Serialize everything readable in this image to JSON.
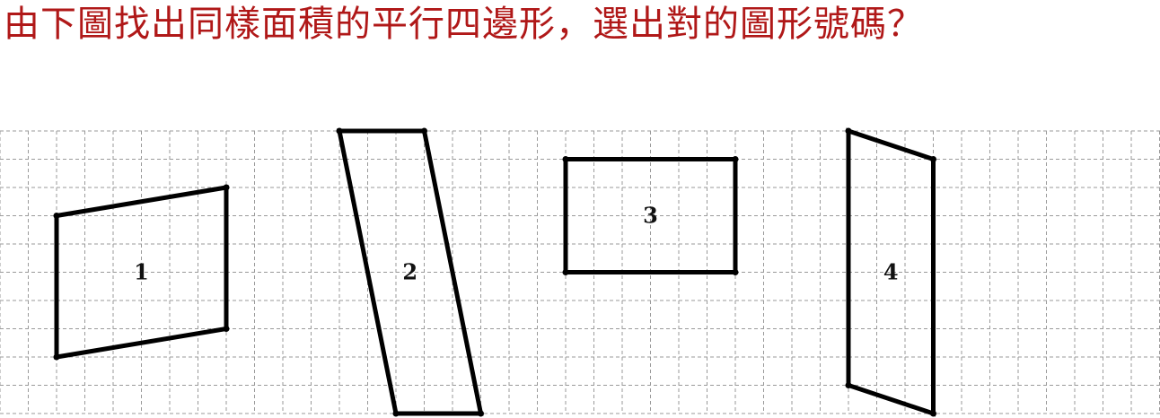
{
  "question": {
    "text": "由下圖找出同樣面積的平行四邊形，選出對的圖形號碼？",
    "color": "#b01818"
  },
  "grid": {
    "columns": 41,
    "rows": 10
  },
  "shapes": [
    {
      "label": "1",
      "vertices": [
        [
          2,
          3
        ],
        [
          8,
          2
        ],
        [
          8,
          7
        ],
        [
          2,
          8
        ]
      ]
    },
    {
      "label": "2",
      "vertices": [
        [
          12,
          0
        ],
        [
          15,
          0
        ],
        [
          17,
          10
        ],
        [
          14,
          10
        ]
      ]
    },
    {
      "label": "3",
      "vertices": [
        [
          20,
          1
        ],
        [
          26,
          1
        ],
        [
          26,
          5
        ],
        [
          20,
          5
        ]
      ]
    },
    {
      "label": "4",
      "vertices": [
        [
          30,
          0
        ],
        [
          33,
          1
        ],
        [
          33,
          10
        ],
        [
          30,
          9
        ]
      ]
    }
  ]
}
